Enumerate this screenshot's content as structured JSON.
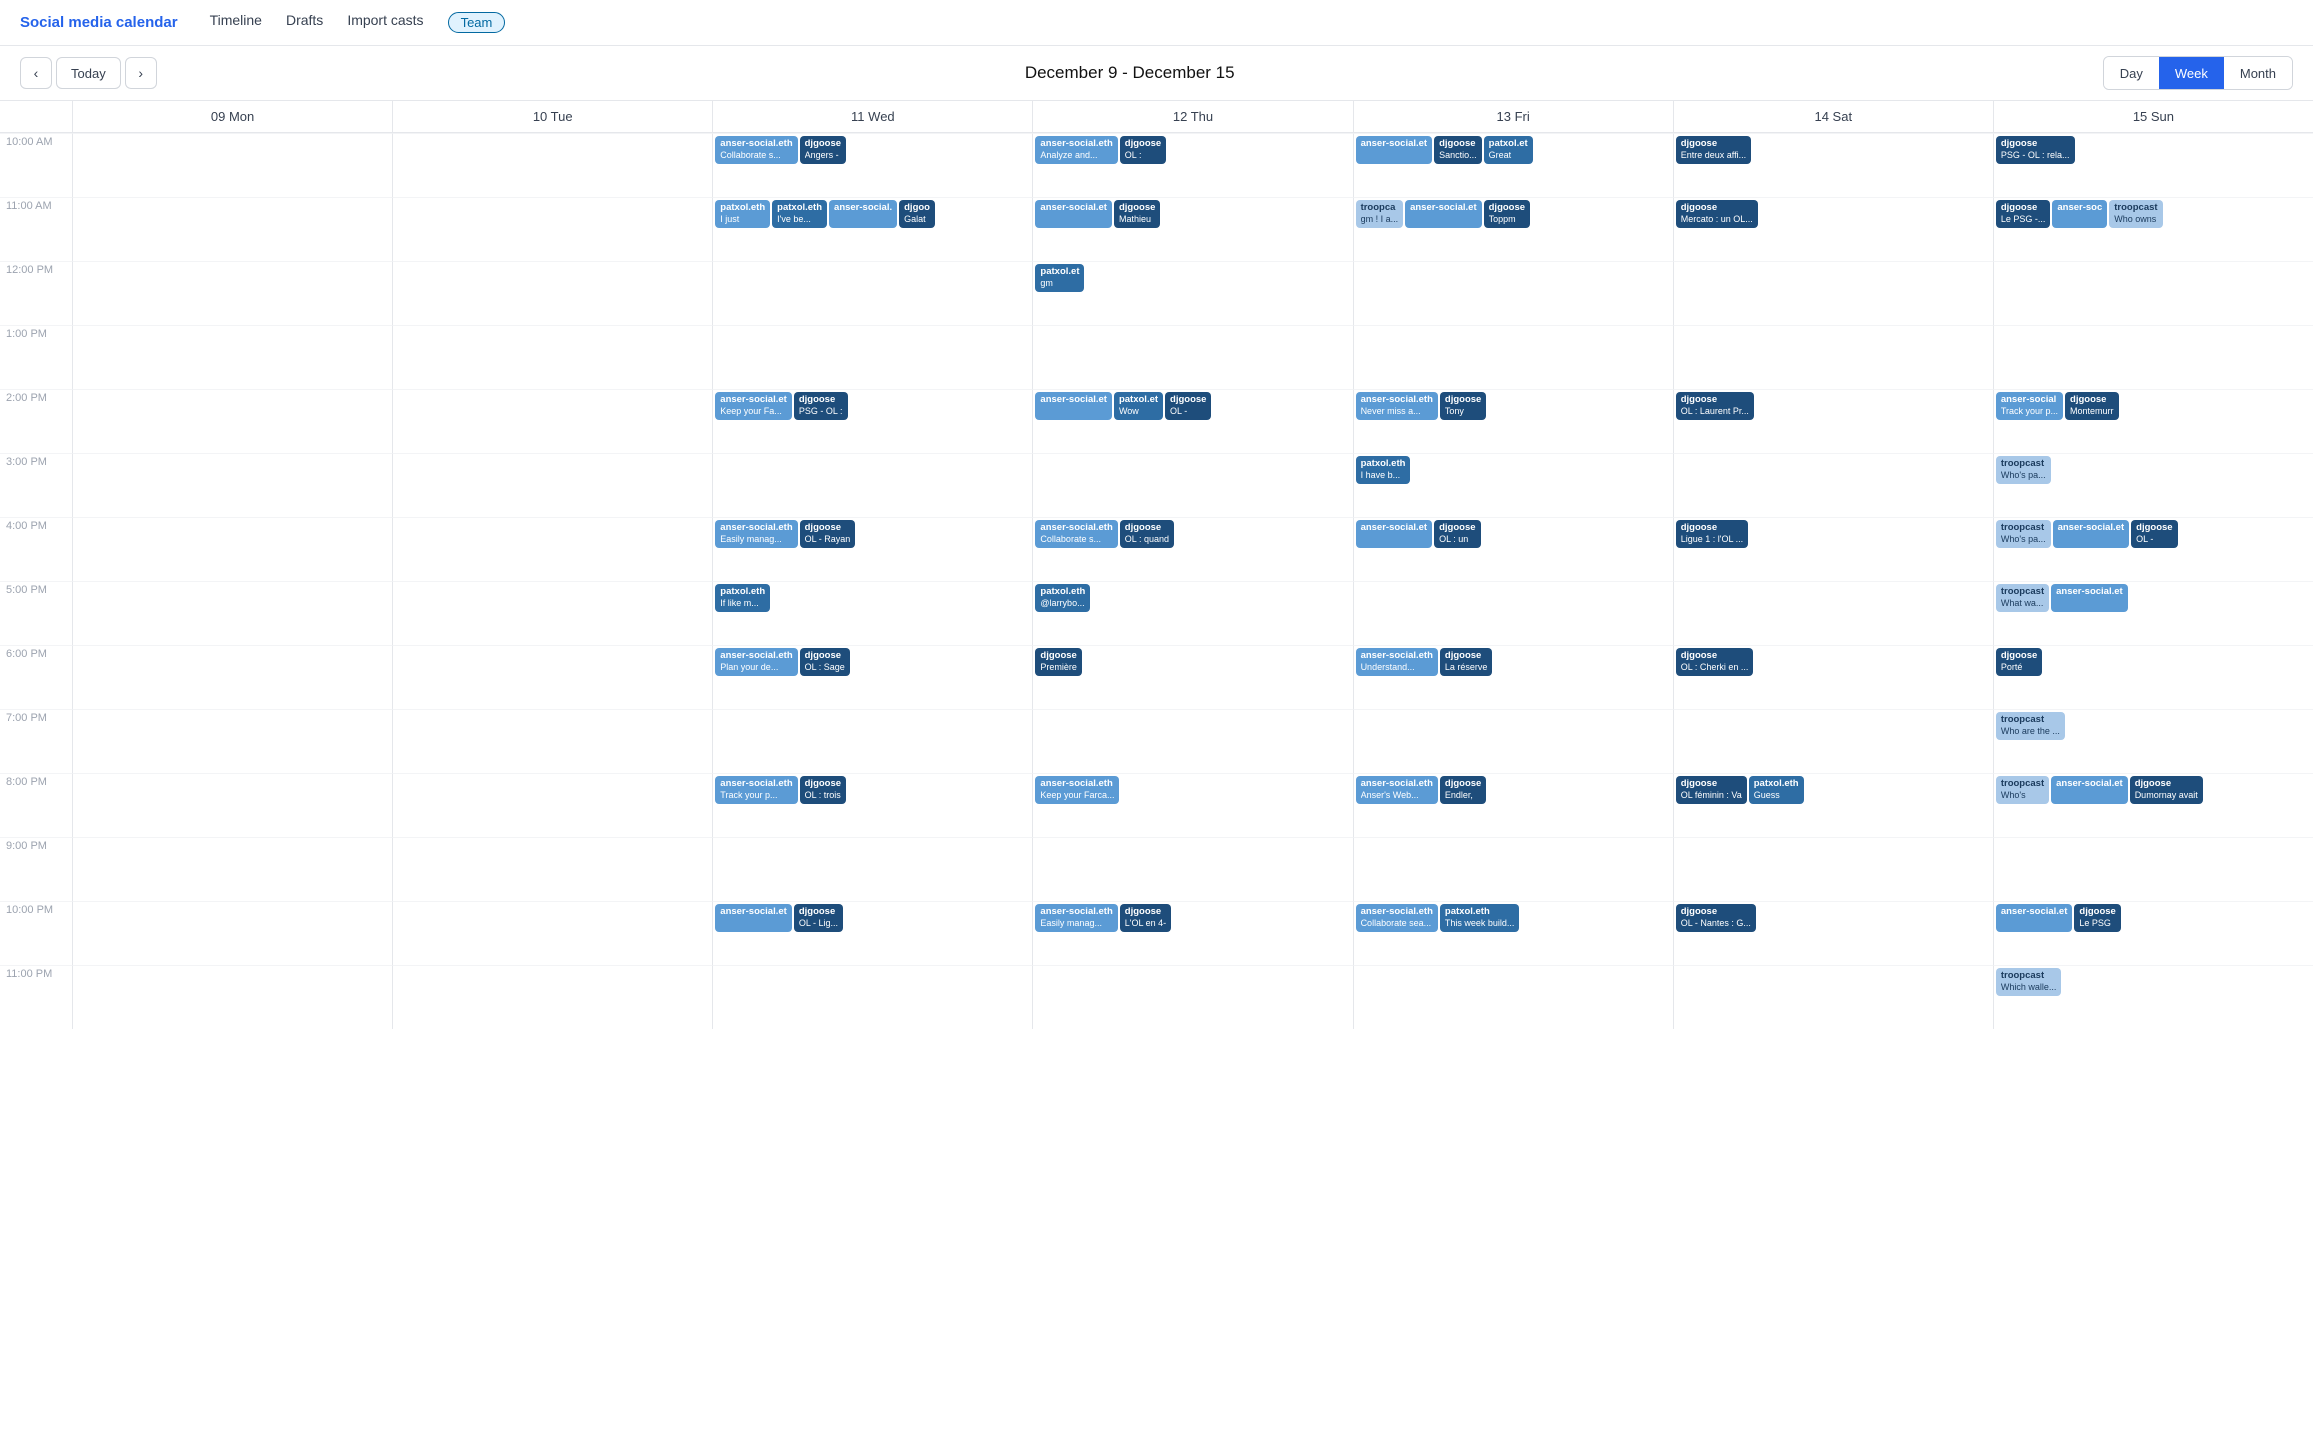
{
  "app": {
    "title": "Social media calendar",
    "nav": [
      "Timeline",
      "Drafts",
      "Import casts"
    ],
    "team_badge": "Team"
  },
  "toolbar": {
    "prev": "‹",
    "today": "Today",
    "next": "›",
    "title": "December 9 - December 15",
    "views": [
      "Day",
      "Week",
      "Month"
    ],
    "active_view": "Week"
  },
  "days": [
    {
      "num": "09",
      "name": "Mon"
    },
    {
      "num": "10",
      "name": "Tue"
    },
    {
      "num": "11",
      "name": "Wed"
    },
    {
      "num": "12",
      "name": "Thu"
    },
    {
      "num": "13",
      "name": "Fri"
    },
    {
      "num": "14",
      "name": "Sat"
    },
    {
      "num": "15",
      "name": "Sun"
    }
  ],
  "times": [
    "10:00 AM",
    "11:00 AM",
    "12:00 PM",
    "1:00 PM",
    "2:00 PM",
    "3:00 PM",
    "4:00 PM",
    "5:00 PM",
    "6:00 PM",
    "7:00 PM",
    "8:00 PM",
    "9:00 PM",
    "10:00 PM",
    "11:00 PM"
  ],
  "events": {
    "wed_10": [
      {
        "cls": "event-blue-light",
        "label": "anser-social.eth",
        "text": "Collaborate s..."
      },
      {
        "cls": "event-blue-dark",
        "label": "djgoose",
        "text": "Angers -"
      }
    ],
    "thu_10": [
      {
        "cls": "event-blue-light",
        "label": "anser-social.eth",
        "text": "Analyze and..."
      },
      {
        "cls": "event-blue-dark",
        "label": "djgoose",
        "text": "OL :"
      }
    ],
    "fri_10": [
      {
        "cls": "event-blue-light",
        "label": "anser-social.et",
        "text": ""
      },
      {
        "cls": "event-blue-dark",
        "label": "djgoose",
        "text": "Sanctio..."
      },
      {
        "cls": "event-blue-med",
        "label": "patxol.et",
        "text": "Great"
      }
    ],
    "sat_10": [
      {
        "cls": "event-blue-dark",
        "label": "djgoose",
        "text": "Entre deux affi..."
      }
    ],
    "sun_10": [
      {
        "cls": "event-blue-dark",
        "label": "djgoose",
        "text": "PSG - OL : rela..."
      }
    ],
    "wed_11": [
      {
        "cls": "event-blue-light",
        "label": "patxol.eth",
        "text": "I just"
      },
      {
        "cls": "event-blue-med",
        "label": "patxol.eth",
        "text": "I've be..."
      },
      {
        "cls": "event-blue-light",
        "label": "anser-social.",
        "text": ""
      },
      {
        "cls": "event-blue-dark",
        "label": "djgoo",
        "text": "Galat"
      }
    ],
    "thu_11": [
      {
        "cls": "event-blue-light",
        "label": "anser-social.et",
        "text": ""
      },
      {
        "cls": "event-blue-dark",
        "label": "djgoose",
        "text": "Mathieu"
      }
    ],
    "fri_11": [
      {
        "cls": "event-blue-pale",
        "label": "troopca",
        "text": "gm ! I a..."
      },
      {
        "cls": "event-blue-light",
        "label": "anser-social.et",
        "text": ""
      },
      {
        "cls": "event-blue-dark",
        "label": "djgoose",
        "text": "Toppm"
      }
    ],
    "sat_11": [
      {
        "cls": "event-blue-dark",
        "label": "djgoose",
        "text": "Mercato : un OL..."
      }
    ],
    "sun_11": [
      {
        "cls": "event-blue-dark",
        "label": "djgoose",
        "text": "Le PSG -..."
      },
      {
        "cls": "event-blue-light",
        "label": "anser-soc",
        "text": ""
      },
      {
        "cls": "event-blue-pale",
        "label": "troopcast",
        "text": "Who owns"
      }
    ],
    "thu_12": [
      {
        "cls": "event-blue-med",
        "label": "patxol.et",
        "text": "gm"
      }
    ],
    "wed_2": [
      {
        "cls": "event-blue-light",
        "label": "anser-social.et",
        "text": "Keep your Fa..."
      },
      {
        "cls": "event-blue-dark",
        "label": "djgoose",
        "text": "PSG - OL :"
      }
    ],
    "thu_2": [
      {
        "cls": "event-blue-light",
        "label": "anser-social.et",
        "text": ""
      },
      {
        "cls": "event-blue-med",
        "label": "patxol.et",
        "text": "Wow"
      },
      {
        "cls": "event-blue-dark",
        "label": "djgoose",
        "text": "OL -"
      }
    ],
    "fri_2": [
      {
        "cls": "event-blue-light",
        "label": "anser-social.eth",
        "text": "Never miss a..."
      },
      {
        "cls": "event-blue-dark",
        "label": "djgoose",
        "text": "Tony"
      }
    ],
    "sat_2": [
      {
        "cls": "event-blue-dark",
        "label": "djgoose",
        "text": "OL : Laurent Pr..."
      }
    ],
    "sun_2": [
      {
        "cls": "event-blue-light",
        "label": "anser-social",
        "text": "Track your p..."
      },
      {
        "cls": "event-blue-dark",
        "label": "djgoose",
        "text": "Montemurr"
      }
    ],
    "fri_3": [
      {
        "cls": "event-blue-med",
        "label": "patxol.eth",
        "text": "I have b..."
      }
    ],
    "wed_4": [
      {
        "cls": "event-blue-light",
        "label": "anser-social.eth",
        "text": "Easily manag..."
      },
      {
        "cls": "event-blue-dark",
        "label": "djgoose",
        "text": "OL - Rayan"
      }
    ],
    "thu_4": [
      {
        "cls": "event-blue-light",
        "label": "anser-social.eth",
        "text": "Collaborate s..."
      },
      {
        "cls": "event-blue-dark",
        "label": "djgoose",
        "text": "OL : quand"
      }
    ],
    "fri_4": [
      {
        "cls": "event-blue-light",
        "label": "anser-social.et",
        "text": ""
      },
      {
        "cls": "event-blue-dark",
        "label": "djgoose",
        "text": "OL : un"
      }
    ],
    "sat_4": [
      {
        "cls": "event-blue-dark",
        "label": "djgoose",
        "text": "Ligue 1 : l'OL ..."
      }
    ],
    "sun_4": [
      {
        "cls": "event-blue-pale",
        "label": "troopcast",
        "text": "Who's pa..."
      },
      {
        "cls": "event-blue-light",
        "label": "anser-social.et",
        "text": ""
      },
      {
        "cls": "event-blue-dark",
        "label": "djgoose",
        "text": "OL -"
      }
    ],
    "wed_5": [
      {
        "cls": "event-blue-med",
        "label": "patxol.eth",
        "text": "If like m..."
      }
    ],
    "thu_5": [
      {
        "cls": "event-blue-med",
        "label": "patxol.eth",
        "text": "@larrybо..."
      }
    ],
    "sun_5": [
      {
        "cls": "event-blue-pale",
        "label": "troopcast",
        "text": "What wa..."
      },
      {
        "cls": "event-blue-light",
        "label": "anser-social.et",
        "text": ""
      }
    ],
    "wed_6": [
      {
        "cls": "event-blue-light",
        "label": "anser-social.eth",
        "text": "Plan your de..."
      },
      {
        "cls": "event-blue-dark",
        "label": "djgoose",
        "text": "OL : Sage"
      }
    ],
    "thu_6": [
      {
        "cls": "event-blue-dark",
        "label": "djgoose",
        "text": "Première"
      }
    ],
    "fri_6": [
      {
        "cls": "event-blue-light",
        "label": "anser-social.eth",
        "text": "Understand..."
      },
      {
        "cls": "event-blue-dark",
        "label": "djgoose",
        "text": "La réserve"
      }
    ],
    "sat_6": [
      {
        "cls": "event-blue-dark",
        "label": "djgoose",
        "text": "OL : Cherki en ..."
      }
    ],
    "sun_6": [
      {
        "cls": "event-blue-dark",
        "label": "djgoose",
        "text": "Porté"
      }
    ],
    "sun_7": [
      {
        "cls": "event-blue-pale",
        "label": "troopcast",
        "text": "Who are the ..."
      }
    ],
    "wed_8": [
      {
        "cls": "event-blue-light",
        "label": "anser-social.eth",
        "text": "Track your p..."
      },
      {
        "cls": "event-blue-dark",
        "label": "djgoose",
        "text": "OL : trois"
      }
    ],
    "thu_8": [
      {
        "cls": "event-blue-light",
        "label": "anser-social.eth",
        "text": "Keep your Farca..."
      }
    ],
    "fri_8": [
      {
        "cls": "event-blue-light",
        "label": "anser-social.eth",
        "text": "Anser's Web..."
      },
      {
        "cls": "event-blue-dark",
        "label": "djgoose",
        "text": "Endler,"
      }
    ],
    "sat_8": [
      {
        "cls": "event-blue-dark",
        "label": "djgoose",
        "text": "OL féminin : Va"
      },
      {
        "cls": "event-blue-med",
        "label": "patxol.eth",
        "text": "Guess"
      }
    ],
    "sun_8": [
      {
        "cls": "event-blue-pale",
        "label": "troopcast",
        "text": "Who's"
      },
      {
        "cls": "event-blue-light",
        "label": "anser-social.et",
        "text": ""
      },
      {
        "cls": "event-blue-dark",
        "label": "djgoose",
        "text": "Dumornay avait"
      }
    ],
    "wed_10pm": [
      {
        "cls": "event-blue-light",
        "label": "anser-social.et",
        "text": ""
      },
      {
        "cls": "event-blue-dark",
        "label": "djgoose",
        "text": "OL - Lig..."
      }
    ],
    "thu_10pm": [
      {
        "cls": "event-blue-light",
        "label": "anser-social.eth",
        "text": "Easily manag..."
      },
      {
        "cls": "event-blue-dark",
        "label": "djgoose",
        "text": "L'OL en 4-"
      }
    ],
    "fri_10pm": [
      {
        "cls": "event-blue-light",
        "label": "anser-social.eth",
        "text": "Collaborate sea..."
      }
    ],
    "sat_10pm": [
      {
        "cls": "event-blue-dark",
        "label": "djgoose",
        "text": "OL - Nantes : G..."
      }
    ],
    "sun_10pm": [
      {
        "cls": "event-blue-light",
        "label": "anser-social.et",
        "text": ""
      },
      {
        "cls": "event-blue-dark",
        "label": "djgoose",
        "text": "Le PSG"
      }
    ],
    "fri_10b": [
      {
        "cls": "event-blue-med",
        "label": "patxol.eth",
        "text": "This week build..."
      }
    ],
    "sun_11pm": [
      {
        "cls": "event-blue-pale",
        "label": "troopcast",
        "text": "Which walle..."
      }
    ]
  }
}
